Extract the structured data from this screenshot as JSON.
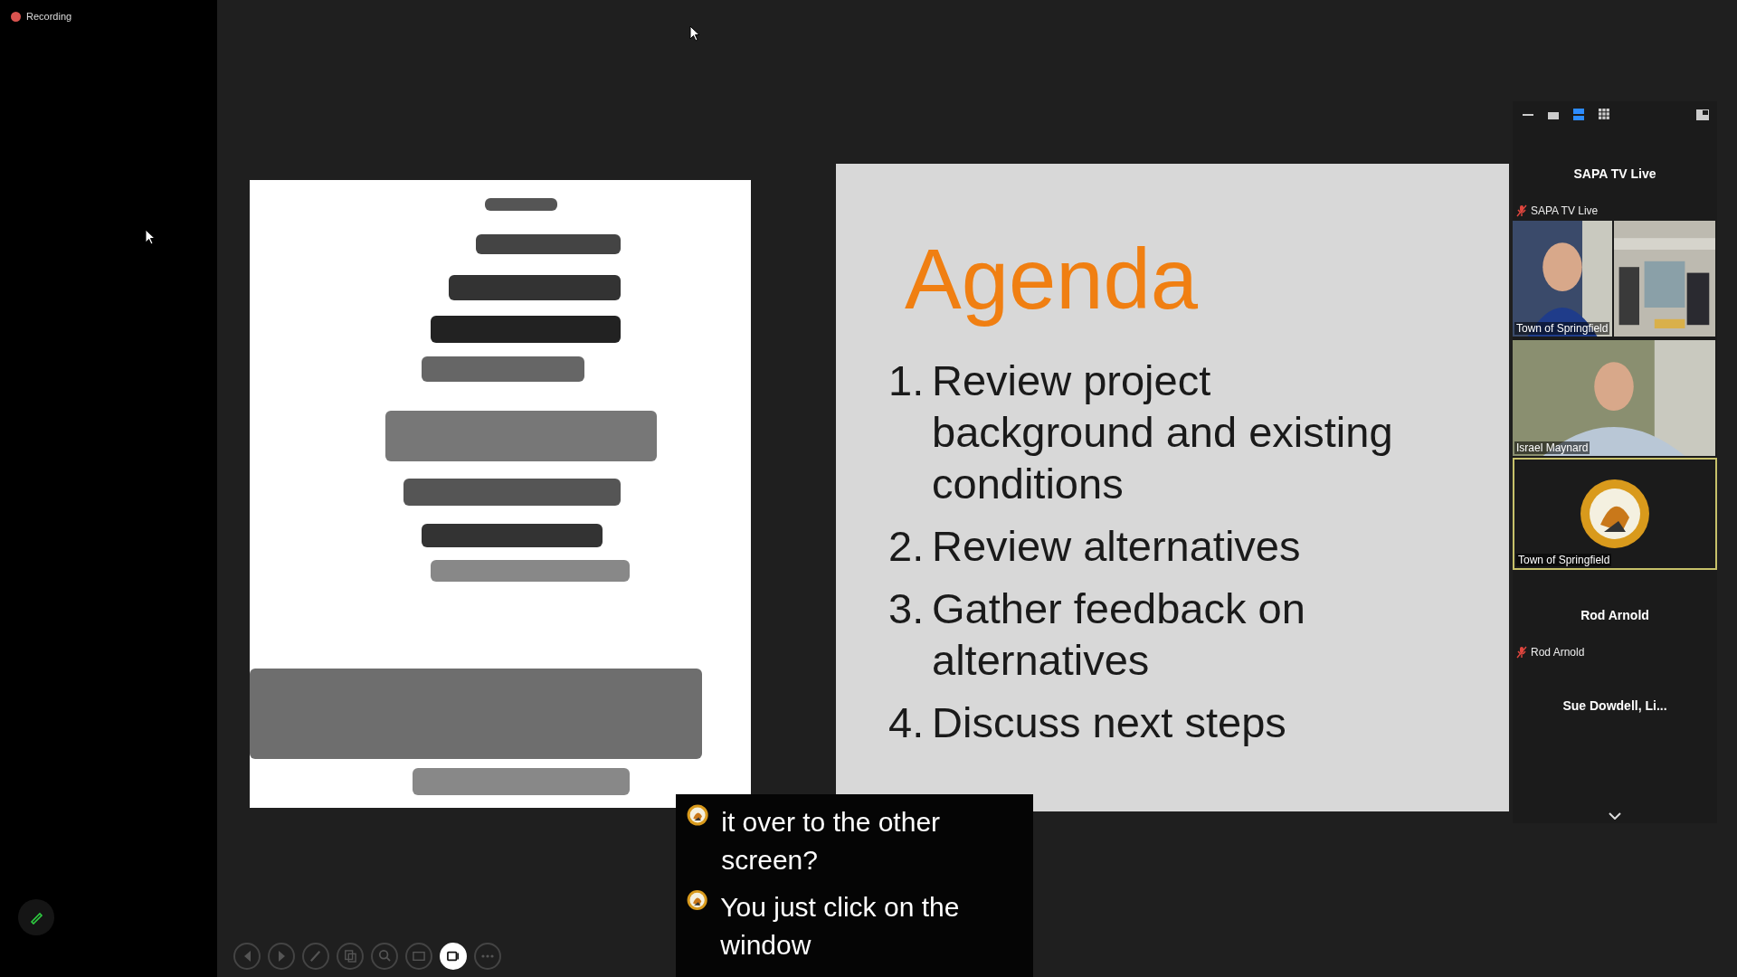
{
  "recording": {
    "label": "Recording"
  },
  "slide": {
    "title": "Agenda",
    "items": [
      {
        "number": "1.",
        "text": "Review project background and existing conditions"
      },
      {
        "number": "2.",
        "text": "Review alternatives"
      },
      {
        "number": "3.",
        "text": "Gather feedback on alternatives"
      },
      {
        "number": "4.",
        "text": "Discuss next steps"
      }
    ]
  },
  "gallery": {
    "views": [
      {
        "kind": "minimize",
        "selected": false
      },
      {
        "kind": "thumbnail",
        "selected": false
      },
      {
        "kind": "speaker",
        "selected": true
      },
      {
        "kind": "grid",
        "selected": false
      }
    ],
    "tiles": [
      {
        "kind": "name_card",
        "name": "SAPA TV Live",
        "label": "SAPA TV Live",
        "muted": true
      },
      {
        "kind": "video_pair",
        "label": "Town of Springfield"
      },
      {
        "kind": "video",
        "label": "Israel Maynard"
      },
      {
        "kind": "logo",
        "label": "Town of Springfield",
        "active": true
      },
      {
        "kind": "name_card",
        "name": "Rod Arnold",
        "label": "Rod Arnold",
        "muted": true
      },
      {
        "kind": "name_card",
        "name": "Sue Dowdell, Li..."
      }
    ]
  },
  "captions": [
    {
      "text": "it over to the other screen?"
    },
    {
      "text": "You just click on the window"
    }
  ],
  "toolbar": [
    {
      "kind": "previous",
      "on": false
    },
    {
      "kind": "next",
      "on": false
    },
    {
      "kind": "annotate",
      "on": false
    },
    {
      "kind": "copy",
      "on": false
    },
    {
      "kind": "zoom",
      "on": false
    },
    {
      "kind": "screen",
      "on": false
    },
    {
      "kind": "camera",
      "on": true
    },
    {
      "kind": "more",
      "on": false
    }
  ]
}
